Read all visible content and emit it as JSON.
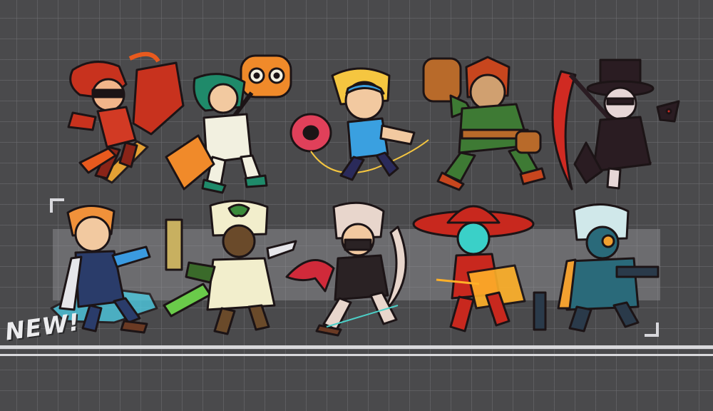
{
  "badge": {
    "text": "NEW!"
  },
  "colors": {
    "background": "#4a4a4c",
    "grid": "#6e6e72",
    "highlight": "#96969b",
    "divider": "#d9d9dc",
    "outline": "#1c1416"
  },
  "rows": [
    {
      "fighters": [
        {
          "id": "red-hair-guitar-fighter",
          "palette": [
            "#c8321e",
            "#e85a1e",
            "#ffb030"
          ]
        },
        {
          "id": "green-hair-hammer-fighter",
          "palette": [
            "#1f8a6a",
            "#f08a2a",
            "#f2f0e0"
          ]
        },
        {
          "id": "blonde-yoyo-fighter",
          "palette": [
            "#3aa0e0",
            "#f5c640",
            "#e0405a"
          ]
        },
        {
          "id": "green-armor-bruiser",
          "palette": [
            "#3e7a34",
            "#c8461e",
            "#b86a2a"
          ]
        },
        {
          "id": "top-hat-scythe-fighter",
          "palette": [
            "#2a1c22",
            "#d02a22",
            "#e6d6d6"
          ]
        }
      ]
    },
    {
      "fighters": [
        {
          "id": "orange-hair-coat-fighter",
          "palette": [
            "#f0913a",
            "#2a3c6a",
            "#4cd0e8"
          ]
        },
        {
          "id": "white-hood-clover-fighter",
          "palette": [
            "#f2eecc",
            "#6a4a2a",
            "#6acb4a"
          ]
        },
        {
          "id": "masked-sickle-fighter",
          "palette": [
            "#e8d6cc",
            "#2a2224",
            "#d02a3a"
          ]
        },
        {
          "id": "red-hat-cowgirl-fighter",
          "palette": [
            "#c8281e",
            "#3ad0c8",
            "#ffb028"
          ]
        },
        {
          "id": "teal-gunner-fighter",
          "palette": [
            "#2a6a7a",
            "#f2a030",
            "#d0e8ea"
          ]
        }
      ]
    }
  ]
}
